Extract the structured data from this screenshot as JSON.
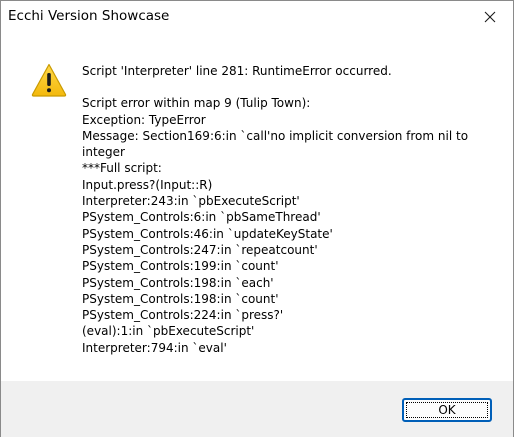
{
  "window": {
    "title": "Ecchi Version Showcase",
    "close_icon": "close-icon"
  },
  "message": {
    "icon": "warning-icon",
    "header": "Script 'Interpreter' line 281: RuntimeError occurred.",
    "lines": [
      "Script error within map 9 (Tulip Town):",
      "Exception: TypeError",
      "Message: Section169:6:in `call'no implicit conversion from nil to integer",
      "***Full script:",
      "Input.press?(Input::R)",
      "Interpreter:243:in `pbExecuteScript'",
      "PSystem_Controls:6:in `pbSameThread'",
      "PSystem_Controls:46:in `updateKeyState'",
      "PSystem_Controls:247:in `repeatcount'",
      "PSystem_Controls:199:in `count'",
      "PSystem_Controls:198:in `each'",
      "PSystem_Controls:198:in `count'",
      "PSystem_Controls:224:in `press?'",
      "(eval):1:in `pbExecuteScript'",
      "Interpreter:794:in `eval'"
    ]
  },
  "buttons": {
    "ok_label": "OK"
  },
  "colors": {
    "warning_fill": "#f5c518",
    "warning_outline": "#c99a00",
    "focus_border": "#005fb8",
    "footer_bg": "#f0f0f0"
  }
}
